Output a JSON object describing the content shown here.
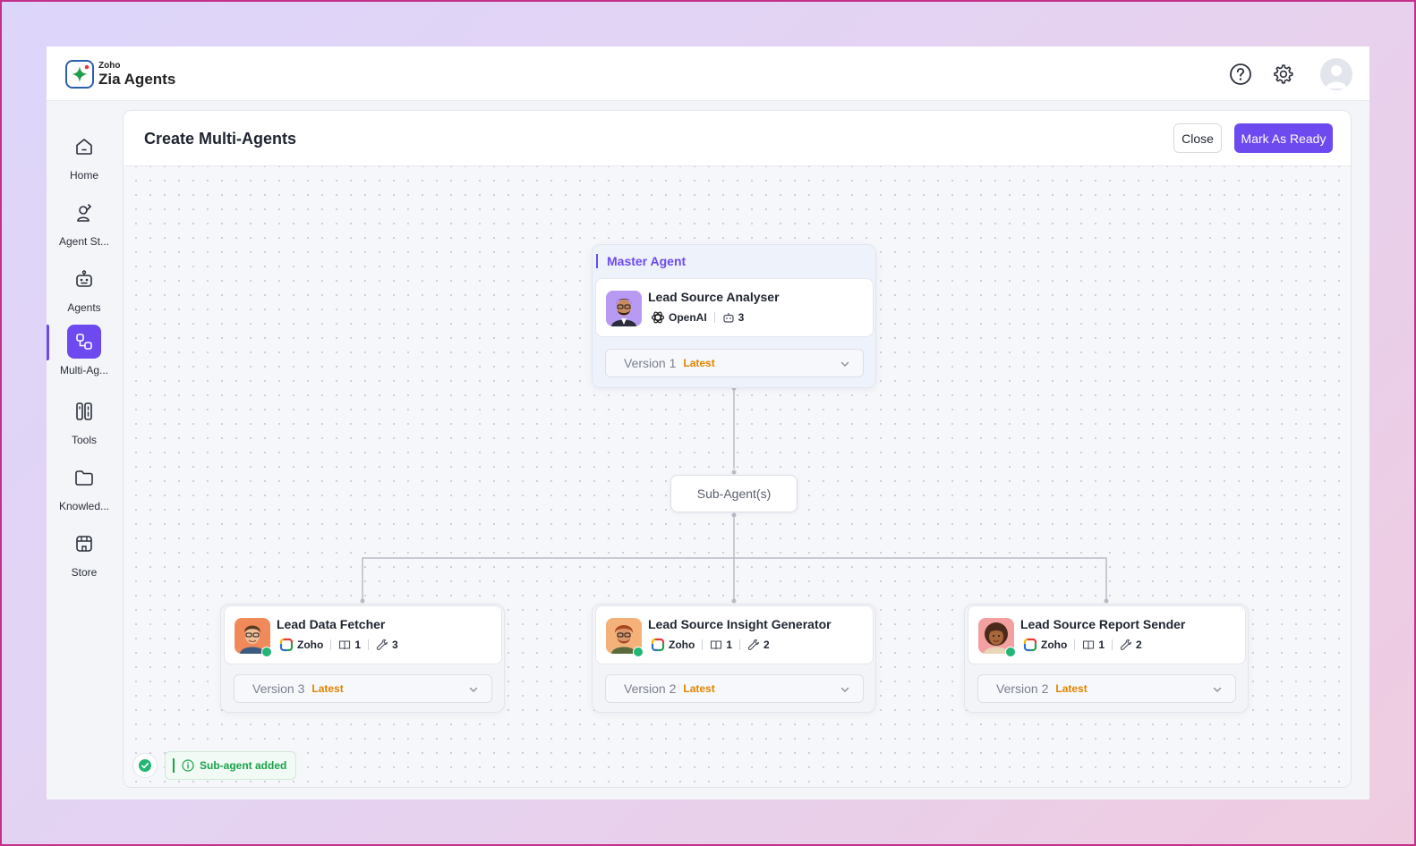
{
  "app": {
    "brand_small": "Zoho",
    "brand_name": "Zia Agents",
    "accent_color": "#6d4aef"
  },
  "topbar": {
    "icons": [
      "help-icon",
      "settings-icon",
      "user-avatar"
    ]
  },
  "sidebar": {
    "items": [
      {
        "label": "Home",
        "icon": "home-icon"
      },
      {
        "label": "Agent St...",
        "icon": "agent-studio-icon"
      },
      {
        "label": "Agents",
        "icon": "robot-icon"
      },
      {
        "label": "Multi-Ag...",
        "icon": "multi-agent-icon",
        "active": true
      },
      {
        "label": "Tools",
        "icon": "tools-icon"
      },
      {
        "label": "Knowled...",
        "icon": "folder-icon"
      },
      {
        "label": "Store",
        "icon": "store-icon"
      }
    ]
  },
  "page": {
    "title": "Create Multi-Agents",
    "close_label": "Close",
    "ready_label": "Mark As Ready"
  },
  "master": {
    "label": "Master Agent",
    "name": "Lead Source Analyser",
    "provider": "OpenAI",
    "agents_count": "3",
    "version": "Version 1",
    "latest": "Latest"
  },
  "subagents_label": "Sub-Agent(s)",
  "subagents": [
    {
      "name": "Lead Data Fetcher",
      "provider": "Zoho",
      "knowledge": "1",
      "tools": "3",
      "version": "Version 3",
      "latest": "Latest"
    },
    {
      "name": "Lead Source Insight Generator",
      "provider": "Zoho",
      "knowledge": "1",
      "tools": "2",
      "version": "Version 2",
      "latest": "Latest"
    },
    {
      "name": "Lead Source Report Sender",
      "provider": "Zoho",
      "knowledge": "1",
      "tools": "2",
      "version": "Version 2",
      "latest": "Latest"
    }
  ],
  "toast": {
    "message": "Sub-agent added",
    "status_color": "#19a34a"
  }
}
